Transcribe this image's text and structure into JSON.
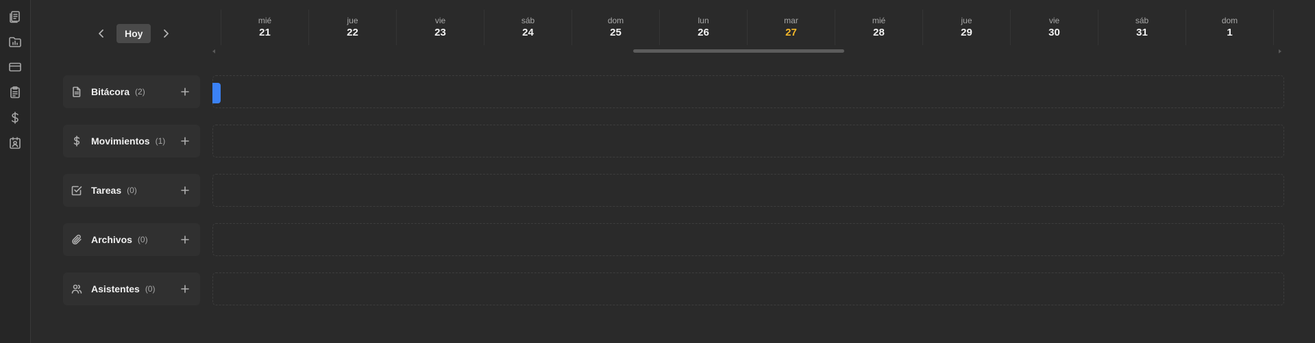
{
  "rail": {
    "items": [
      {
        "icon": "document-stack-icon"
      },
      {
        "icon": "folder-chart-icon"
      },
      {
        "icon": "credit-card-icon"
      },
      {
        "icon": "clipboard-icon"
      },
      {
        "icon": "dollar-icon"
      },
      {
        "icon": "contact-badge-icon"
      }
    ]
  },
  "nav": {
    "today_label": "Hoy"
  },
  "days": [
    {
      "dow": "mié",
      "num": "21"
    },
    {
      "dow": "jue",
      "num": "22"
    },
    {
      "dow": "vie",
      "num": "23"
    },
    {
      "dow": "sáb",
      "num": "24"
    },
    {
      "dow": "dom",
      "num": "25"
    },
    {
      "dow": "lun",
      "num": "26"
    },
    {
      "dow": "mar",
      "num": "27"
    },
    {
      "dow": "mié",
      "num": "28"
    },
    {
      "dow": "jue",
      "num": "29"
    },
    {
      "dow": "vie",
      "num": "30"
    },
    {
      "dow": "sáb",
      "num": "31"
    },
    {
      "dow": "dom",
      "num": "1"
    }
  ],
  "today_highlight_color": "#f5b729",
  "event_color": "#3b82f6",
  "rows": [
    {
      "title": "Bitácora",
      "count": "(2)",
      "icon": "document-icon"
    },
    {
      "title": "Movimientos",
      "count": "(1)",
      "icon": "dollar-icon"
    },
    {
      "title": "Tareas",
      "count": "(0)",
      "icon": "checkbox-icon"
    },
    {
      "title": "Archivos",
      "count": "(0)",
      "icon": "paperclip-icon"
    },
    {
      "title": "Asistentes",
      "count": "(0)",
      "icon": "users-icon"
    }
  ]
}
